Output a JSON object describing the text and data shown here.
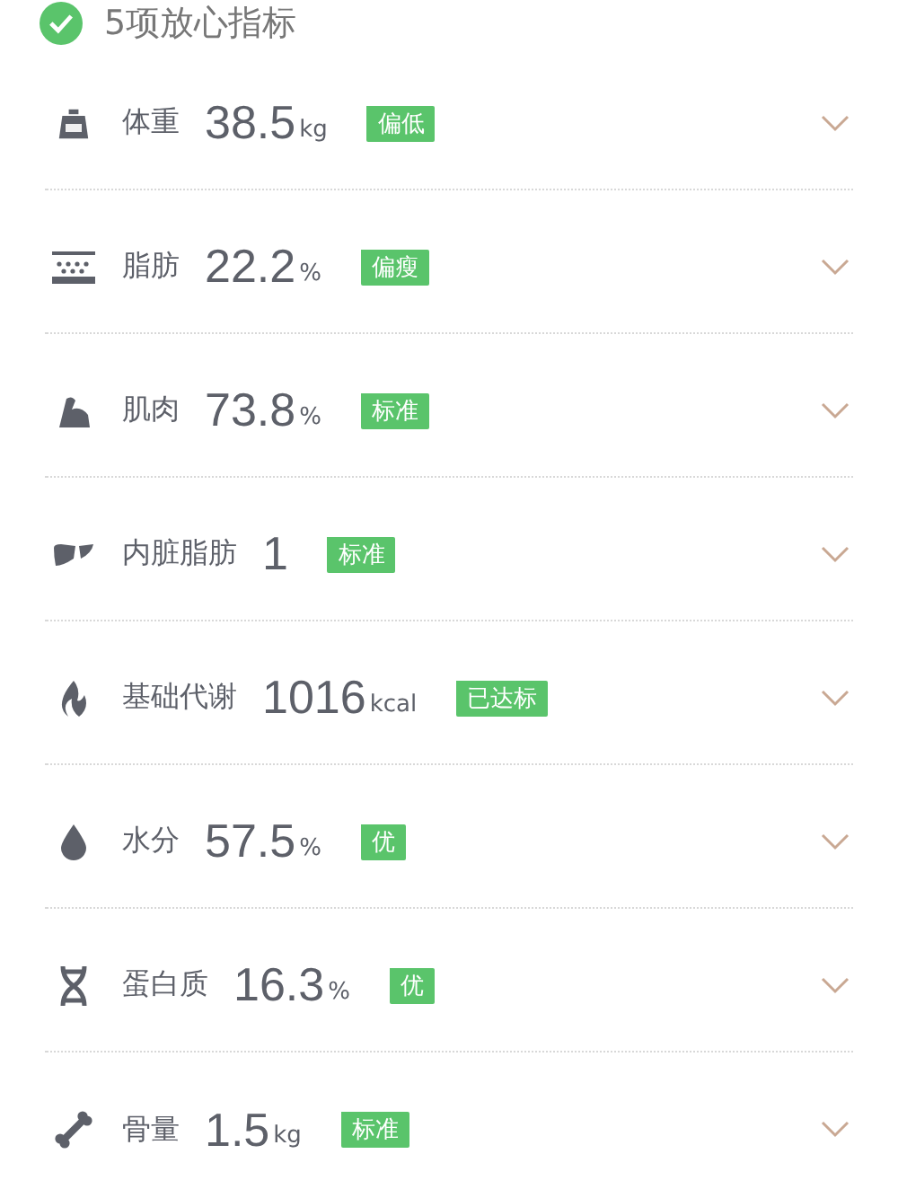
{
  "header": {
    "title": "5项放心指标",
    "checked": true
  },
  "metrics": [
    {
      "name": "体重",
      "value": "38.5",
      "unit": "kg",
      "status": "偏低",
      "expanded": false
    },
    {
      "name": "脂肪",
      "value": "22.2",
      "unit": "%",
      "status": "偏瘦",
      "expanded": false
    },
    {
      "name": "肌肉",
      "value": "73.8",
      "unit": "%",
      "status": "标准",
      "expanded": false
    },
    {
      "name": "内脏脂肪",
      "value": "1",
      "status": "标准",
      "expanded": false
    },
    {
      "name": "基础代谢",
      "value": "1016",
      "unit": "kcal",
      "status": "已达标",
      "expanded": false
    },
    {
      "name": "水分",
      "value": "57.5",
      "unit": "%",
      "status": "优",
      "expanded": false
    },
    {
      "name": "蛋白质",
      "value": "16.3",
      "unit": "%",
      "status": "优",
      "expanded": false
    },
    {
      "name": "骨量",
      "value": "1.5",
      "unit": "kg",
      "status": "标准",
      "expanded": false
    }
  ]
}
